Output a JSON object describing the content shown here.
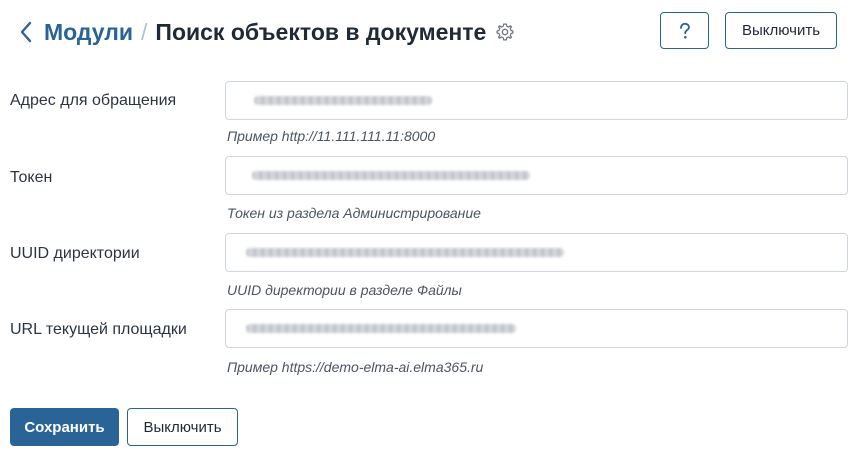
{
  "header": {
    "breadcrumb_parent": "Модули",
    "breadcrumb_separator": "/",
    "title": "Поиск объектов в документе",
    "back_icon": "chevron-left-icon",
    "settings_icon": "gear-icon",
    "help_icon": "question-icon",
    "disable_label": "Выключить"
  },
  "form": {
    "fields": [
      {
        "label": "Адрес для обращения",
        "value": "",
        "hint": "Пример http://11.111.111.11:8000",
        "obscured": true
      },
      {
        "label": "Токен",
        "value": "",
        "hint": "Токен из раздела Администрирование",
        "obscured": true
      },
      {
        "label": "UUID директории",
        "value": "",
        "hint": "UUID директории в разделе Файлы",
        "obscured": true
      },
      {
        "label": "URL текущей площадки",
        "value": "",
        "hint": "Пример https://demo-elma-ai.elma365.ru",
        "obscured": true
      }
    ]
  },
  "footer": {
    "save_label": "Сохранить",
    "disable_label": "Выключить"
  },
  "colors": {
    "accent": "#2a6496",
    "text": "#1f2a36",
    "border": "#cfd6dd"
  }
}
